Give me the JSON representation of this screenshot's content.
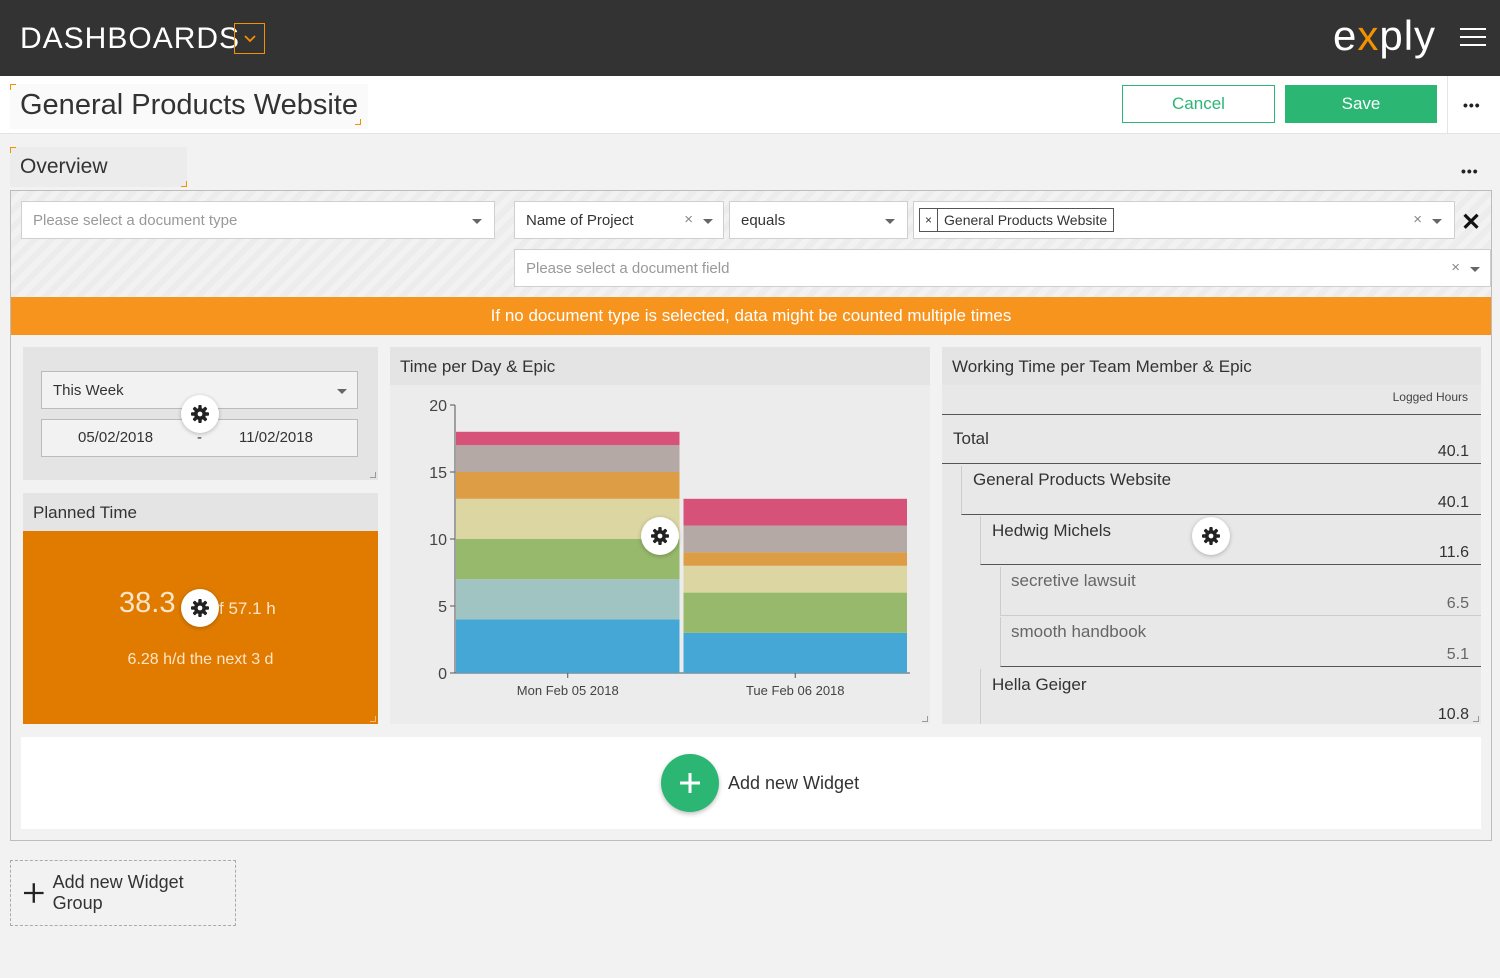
{
  "topbar": {
    "title": "DASHBOARDS",
    "logo_a": "e",
    "logo_x": "x",
    "logo_b": "ply"
  },
  "header": {
    "page_title": "General Products Website",
    "cancel_label": "Cancel",
    "save_label": "Save",
    "more": "•••"
  },
  "group": {
    "title": "Overview",
    "more": "•••"
  },
  "filters": {
    "doc_type_placeholder": "Please select a document type",
    "field_value": "Name of Project",
    "operator_value": "equals",
    "value_tag": "General Products Website",
    "doc_field_placeholder": "Please select a document field",
    "clear_glyph": "×",
    "remove_glyph": "✕"
  },
  "warning": "If no document type is selected, data might be counted multiple times",
  "date_widget": {
    "period": "This Week",
    "from": "05/02/2018",
    "separator": "-",
    "to": "11/02/2018"
  },
  "planned_widget": {
    "title": "Planned Time",
    "value": "38.3",
    "of_text": "f 57.1 h",
    "subtitle": "6.28 h/d the next 3 d"
  },
  "chart_widget": {
    "title": "Time per Day & Epic"
  },
  "chart_data": {
    "type": "bar",
    "stacked": true,
    "categories": [
      "Mon Feb 05 2018",
      "Tue Feb 06 2018"
    ],
    "ylim": [
      0,
      20
    ],
    "yticks": [
      0,
      5,
      10,
      15,
      20
    ],
    "grid": false,
    "series": [
      {
        "color": "#45a7d6",
        "values": [
          4.0,
          3.0
        ]
      },
      {
        "color": "#9fc4c2",
        "values": [
          3.0,
          0
        ]
      },
      {
        "color": "#97b96b",
        "values": [
          3.0,
          3.0
        ]
      },
      {
        "color": "#dcd6a2",
        "values": [
          3.0,
          2.0
        ]
      },
      {
        "color": "#dc9d44",
        "values": [
          2.0,
          1.0
        ]
      },
      {
        "color": "#b5a9a5",
        "values": [
          2.0,
          2.0
        ]
      },
      {
        "color": "#d75279",
        "values": [
          1.0,
          2.0
        ]
      }
    ]
  },
  "table_widget": {
    "title": "Working Time per Team Member & Epic",
    "col_header": "Logged Hours",
    "rows": [
      {
        "label": "Total",
        "value": "40.1"
      },
      {
        "label": "General Products Website",
        "value": "40.1"
      },
      {
        "label": "Hedwig Michels",
        "value": "11.6"
      },
      {
        "label": "secretive lawsuit",
        "value": "6.5"
      },
      {
        "label": "smooth handbook",
        "value": "5.1"
      },
      {
        "label": "Hella Geiger",
        "value": "10.8"
      }
    ]
  },
  "add_widget_label": "Add new Widget",
  "add_group_label": "Add new Widget Group",
  "colors": {
    "accent": "#f39200",
    "green": "#2bb673",
    "warning": "#f7941d",
    "planned": "#e07b00"
  }
}
